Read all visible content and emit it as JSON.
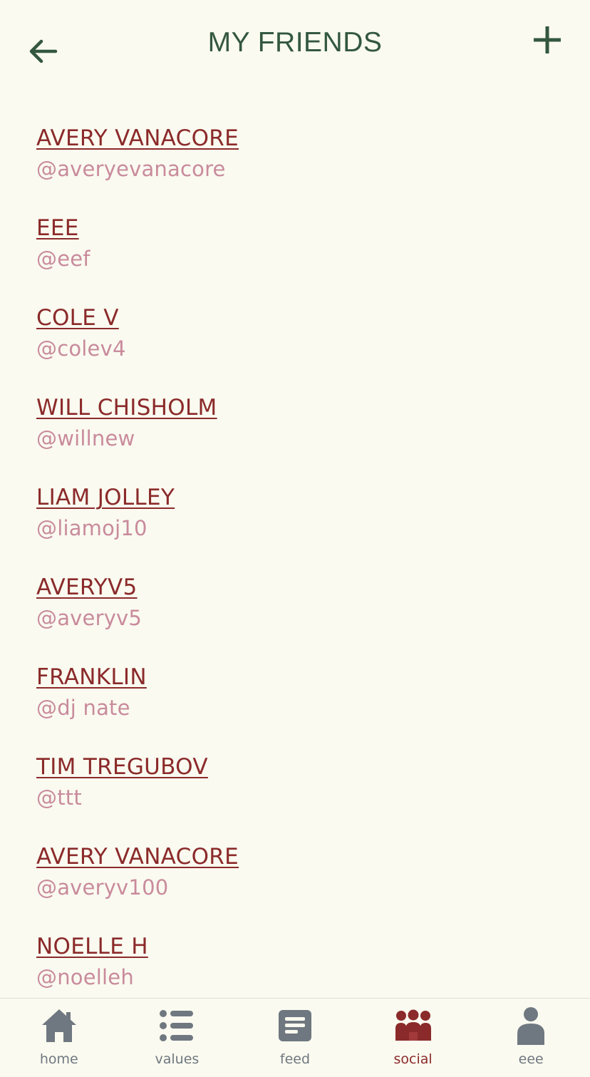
{
  "header": {
    "title": "MY FRIENDS",
    "back_icon": "arrow-left-icon",
    "add_icon": "plus-icon"
  },
  "friends": [
    {
      "name": "AVERY VANACORE",
      "handle": "@averyevanacore"
    },
    {
      "name": "EEE",
      "handle": "@eef"
    },
    {
      "name": "COLE V",
      "handle": "@colev4"
    },
    {
      "name": "WILL CHISHOLM",
      "handle": "@willnew"
    },
    {
      "name": "LIAM JOLLEY",
      "handle": "@liamoj10"
    },
    {
      "name": "AVERYV5",
      "handle": "@averyv5"
    },
    {
      "name": "FRANKLIN",
      "handle": "@dj nate"
    },
    {
      "name": "TIM TREGUBOV",
      "handle": "@ttt"
    },
    {
      "name": "AVERY VANACORE",
      "handle": "@averyv100"
    },
    {
      "name": "NOELLE H",
      "handle": "@noelleh"
    }
  ],
  "tabs": [
    {
      "label": "home",
      "icon": "home-icon",
      "active": false
    },
    {
      "label": "values",
      "icon": "list-icon",
      "active": false
    },
    {
      "label": "feed",
      "icon": "feed-icon",
      "active": false
    },
    {
      "label": "social",
      "icon": "people-icon",
      "active": true
    },
    {
      "label": "eee",
      "icon": "person-icon",
      "active": false
    }
  ],
  "colors": {
    "background": "#fafaf0",
    "title": "#33573f",
    "name": "#8b2a2a",
    "handle": "#c98b9c",
    "tab_inactive": "#6f7880",
    "tab_active": "#8b2a2a"
  }
}
